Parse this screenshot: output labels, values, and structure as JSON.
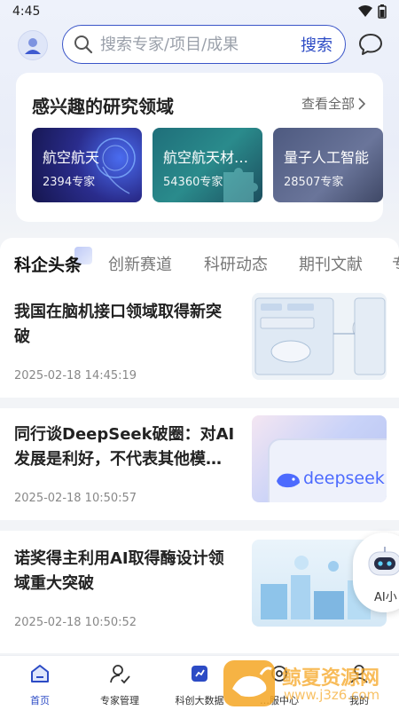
{
  "status_bar": {
    "time": "4:45"
  },
  "header": {
    "search_placeholder": "搜索专家/项目/成果",
    "search_button": "搜索"
  },
  "research": {
    "title": "感兴趣的研究领域",
    "see_all": "查看全部",
    "fields": [
      {
        "name": "航空航天",
        "count": "2394专家"
      },
      {
        "name": "航空航天材…",
        "count": "54360专家"
      },
      {
        "name": "量子人工智能",
        "count": "28507专家"
      }
    ]
  },
  "tabs": [
    "科企头条",
    "创新赛道",
    "科研动态",
    "期刊文献",
    "专"
  ],
  "news": [
    {
      "title": "我国在脑机接口领域取得新突破",
      "date": "2025-02-18 14:45:19"
    },
    {
      "title": "同行谈DeepSeek破圈：对AI发展是利好，不代表其他模…",
      "date": "2025-02-18 10:50:57",
      "thumb_text": "deepseek"
    },
    {
      "title": "诺奖得主利用AI取得酶设计领域重大突破",
      "date": "2025-02-18 10:50:52"
    }
  ],
  "ai_float": {
    "label": "AI小"
  },
  "bottom_nav": [
    {
      "label": "首页",
      "icon": "home-icon",
      "active": true
    },
    {
      "label": "专家管理",
      "icon": "expert-icon",
      "active": false
    },
    {
      "label": "科创大数据",
      "icon": "bigdata-icon",
      "active": false
    },
    {
      "label": "…服中心",
      "icon": "service-icon",
      "active": false
    },
    {
      "label": "我的",
      "icon": "profile-icon",
      "active": false
    }
  ],
  "watermark": {
    "text": "鲸夏资源网",
    "url": "www.j3z6.com"
  },
  "colors": {
    "accent": "#2c4bc5",
    "background": "#f2f4f7",
    "watermark": "#f5a623"
  }
}
